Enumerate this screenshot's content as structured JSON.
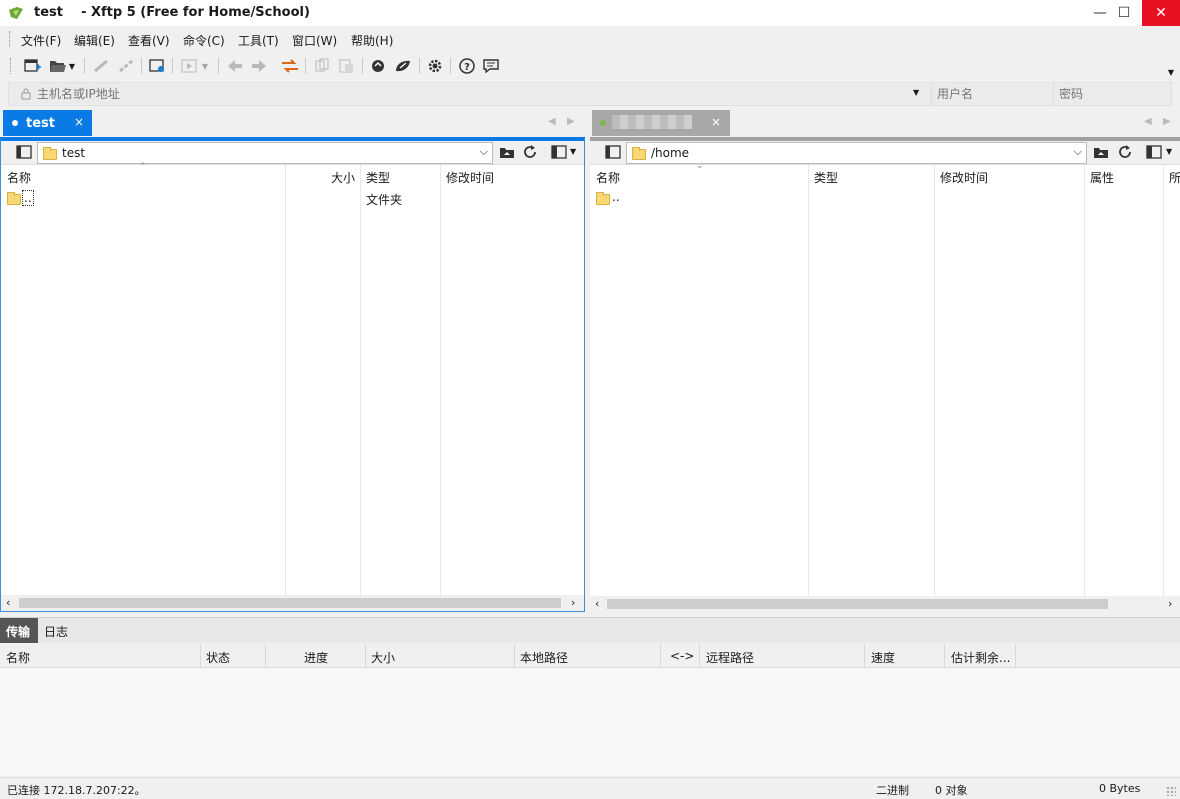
{
  "window": {
    "title": "test    - Xftp 5 (Free for Home/School)",
    "minimize": "—",
    "maximize": "☐",
    "close": "✕"
  },
  "menu": [
    "文件(F)",
    "编辑(E)",
    "查看(V)",
    "命令(C)",
    "工具(T)",
    "窗口(W)",
    "帮助(H)"
  ],
  "address": {
    "host_placeholder": "主机名或IP地址",
    "user_placeholder": "用户名",
    "password_placeholder": "密码"
  },
  "tabs": {
    "left": {
      "label": "test",
      "close": "×"
    },
    "right": {
      "label": "",
      "close": "×"
    }
  },
  "left_pane": {
    "path": "test",
    "columns": [
      "名称",
      "大小",
      "类型",
      "修改时间"
    ],
    "rows": [
      {
        "name": "..",
        "size": "",
        "type": "文件夹",
        "modified": ""
      }
    ]
  },
  "right_pane": {
    "path": "/home",
    "columns": [
      "名称",
      "类型",
      "修改时间",
      "属性",
      "所"
    ],
    "rows": [
      {
        "name": "..",
        "type": "",
        "modified": "",
        "attr": ""
      }
    ]
  },
  "bottom_tabs": [
    "传输",
    "日志"
  ],
  "transfer_columns": [
    "名称",
    "状态",
    "进度",
    "大小",
    "本地路径",
    "<->",
    "远程路径",
    "速度",
    "估计剩余..."
  ],
  "status": {
    "connection": "已连接 172.18.7.207:22。",
    "mode": "二进制",
    "objects": "0 对象",
    "bytes": "0 Bytes"
  },
  "colors": {
    "accent": "#0a7ae6",
    "close_red": "#e81123",
    "folder": "#f8d775"
  }
}
